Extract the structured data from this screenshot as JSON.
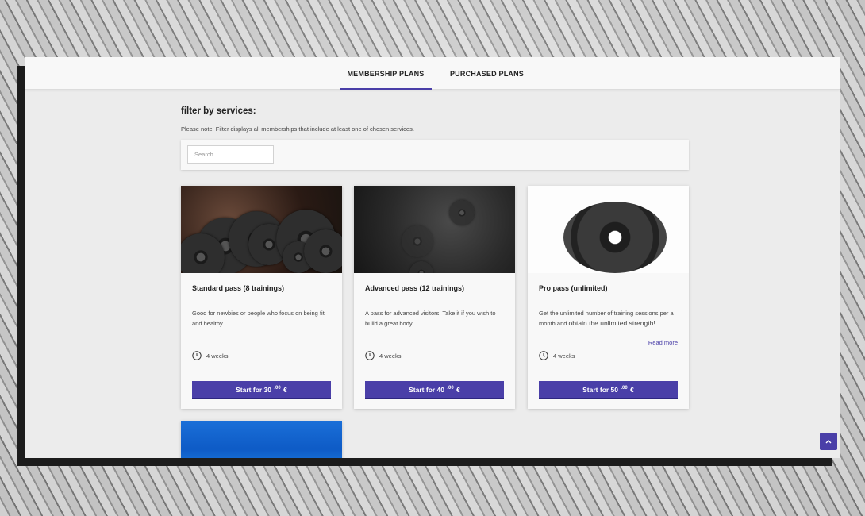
{
  "tabs": [
    {
      "label": "MEMBERSHIP PLANS",
      "active": true
    },
    {
      "label": "PURCHASED PLANS",
      "active": false
    }
  ],
  "filter": {
    "title": "filter by services:",
    "note": "Please note! Filter displays all memberships that include at least one of chosen services.",
    "search_placeholder": "Search"
  },
  "plans": [
    {
      "title": "Standard pass (8 trainings)",
      "description": "Good for newbies or people who focus on being fit and healthy.",
      "duration": "4 weeks",
      "button_prefix": "Start for 30",
      "button_cents": ".00",
      "button_currency": "€"
    },
    {
      "title": "Advanced pass (12 trainings)",
      "description": "A pass for advanced visitors. Take it if you wish to build a great body!",
      "duration": "4 weeks",
      "button_prefix": "Start for 40",
      "button_cents": ".00",
      "button_currency": "€"
    },
    {
      "title": "Pro pass (unlimited)",
      "description_a": "Get the unlimited number of training sessions per a month and",
      "description_b": "obtain the unlimited strength!",
      "read_more": "Read more",
      "duration": "4 weeks",
      "button_prefix": "Start for 50",
      "button_cents": ".00",
      "button_currency": "€"
    }
  ],
  "colors": {
    "accent": "#4a3fa8",
    "background": "#ececec",
    "card": "#f8f8f8"
  },
  "scroll_top_icon": "chevron-up-icon"
}
